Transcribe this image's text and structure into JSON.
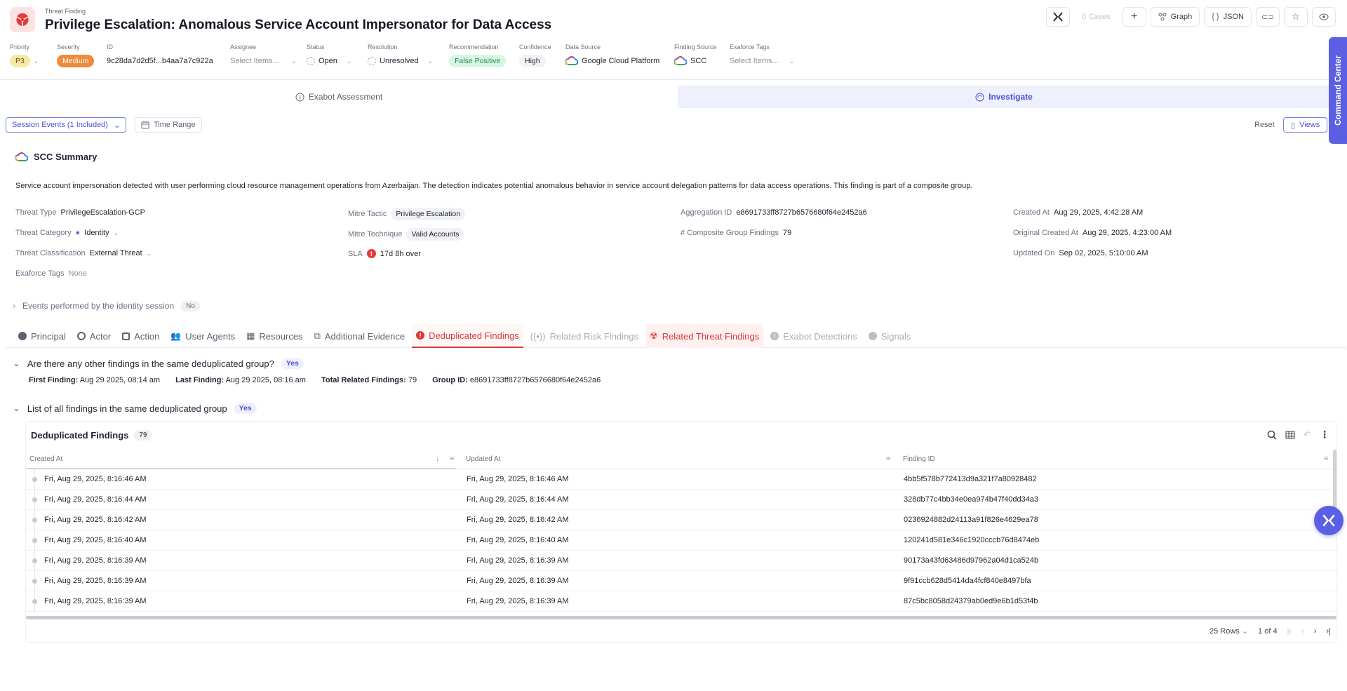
{
  "header": {
    "kicker": "Threat Finding",
    "title": "Privilege Escalation: Anomalous Service Account Impersonator for Data Access",
    "actions": {
      "cases": "0 Cases",
      "graph": "Graph",
      "json": "JSON"
    }
  },
  "meta": {
    "priority": {
      "label": "Priority",
      "value": "P3"
    },
    "severity": {
      "label": "Severity",
      "value": "Medium"
    },
    "id": {
      "label": "ID",
      "value": "9c28da7d2d5f...b4aa7a7c922a"
    },
    "assignee": {
      "label": "Assignee",
      "value": "Select Items..."
    },
    "status": {
      "label": "Status",
      "value": "Open"
    },
    "resolution": {
      "label": "Resolution",
      "value": "Unresolved"
    },
    "recommendation": {
      "label": "Recommendation",
      "value": "False Positive"
    },
    "confidence": {
      "label": "Confidence",
      "value": "High"
    },
    "data_source": {
      "label": "Data Source",
      "value": "Google Cloud Platform"
    },
    "finding_source": {
      "label": "Finding Source",
      "value": "SCC"
    },
    "exaforce_tags": {
      "label": "Exaforce Tags",
      "value": "Select Items..."
    }
  },
  "tabs": {
    "assessment": "Exabot Assessment",
    "investigate": "Investigate"
  },
  "filters": {
    "session": "Session Events (1 Included)",
    "time_range": "Time Range",
    "reset": "Reset",
    "views": "Views"
  },
  "command_center": "Command Center",
  "summary": {
    "title": "SCC Summary",
    "description": "Service account impersonation detected with user performing cloud resource management operations from Azerbaijan. The detection indicates potential anomalous behavior in service account delegation patterns for data access operations. This finding is part of a composite group.",
    "threat_type": {
      "label": "Threat Type",
      "value": "PrivilegeEscalation-GCP"
    },
    "threat_category": {
      "label": "Threat Category",
      "value": "Identity"
    },
    "threat_classification": {
      "label": "Threat Classification",
      "value": "External Threat"
    },
    "exaforce_tags": {
      "label": "Exaforce Tags",
      "value": "None"
    },
    "mitre_tactic": {
      "label": "Mitre Tactic",
      "value": "Privilege Escalation"
    },
    "mitre_technique": {
      "label": "Mitre Technique",
      "value": "Valid Accounts"
    },
    "sla": {
      "label": "SLA",
      "value": "17d 8h over"
    },
    "aggregation_id": {
      "label": "Aggregation ID",
      "value": "e8691733ff8727b6576680f64e2452a6"
    },
    "composite": {
      "label": "# Composite Group Findings",
      "value": "79"
    },
    "created_at": {
      "label": "Created At",
      "value": "Aug 29, 2025, 4:42:28 AM"
    },
    "original_created_at": {
      "label": "Original Created At",
      "value": "Aug 29, 2025, 4:23:00 AM"
    },
    "updated_on": {
      "label": "Updated On",
      "value": "Sep 02, 2025, 5:10:00 AM"
    }
  },
  "events": {
    "label": "Events performed by the identity session",
    "badge": "No"
  },
  "subtabs": [
    "Principal",
    "Actor",
    "Action",
    "User Agents",
    "Resources",
    "Additional Evidence",
    "Deduplicated Findings",
    "Related Risk Findings",
    "Related Threat Findings",
    "Exabot Detections",
    "Signals"
  ],
  "dedup": {
    "question1": "Are there any other findings in the same deduplicated group?",
    "answer1": "Yes",
    "first_finding_label": "First Finding:",
    "first_finding": "Aug 29 2025, 08:14 am",
    "last_finding_label": "Last Finding:",
    "last_finding": "Aug 29 2025, 08:16 am",
    "total_label": "Total Related Findings:",
    "total": "79",
    "group_label": "Group ID:",
    "group_id": "e8691733ff8727b6576680f64e2452a6",
    "question2": "List of all findings in the same deduplicated group",
    "answer2": "Yes"
  },
  "table": {
    "title": "Deduplicated Findings",
    "count": "79",
    "columns": [
      "Created At",
      "Updated At",
      "Finding ID"
    ],
    "rows": [
      [
        "Fri, Aug 29, 2025, 8:16:46 AM",
        "Fri, Aug 29, 2025, 8:16:46 AM",
        "4bb5f578b772413d9a321f7a80928482"
      ],
      [
        "Fri, Aug 29, 2025, 8:16:44 AM",
        "Fri, Aug 29, 2025, 8:16:44 AM",
        "328db77c4bb34e0ea974b47f40dd34a3"
      ],
      [
        "Fri, Aug 29, 2025, 8:16:42 AM",
        "Fri, Aug 29, 2025, 8:16:42 AM",
        "0236924882d24113a91f826e4629ea78"
      ],
      [
        "Fri, Aug 29, 2025, 8:16:40 AM",
        "Fri, Aug 29, 2025, 8:16:40 AM",
        "120241d581e346c1920cccb76d8474eb"
      ],
      [
        "Fri, Aug 29, 2025, 8:16:39 AM",
        "Fri, Aug 29, 2025, 8:16:39 AM",
        "90173a43fd63486d97962a04d1ca524b"
      ],
      [
        "Fri, Aug 29, 2025, 8:16:39 AM",
        "Fri, Aug 29, 2025, 8:16:39 AM",
        "9f91ccb628d5414da4fcf840e8497bfa"
      ],
      [
        "Fri, Aug 29, 2025, 8:16:39 AM",
        "Fri, Aug 29, 2025, 8:16:39 AM",
        "87c5bc8058d24379ab0ed9e6b1d53f4b"
      ]
    ],
    "rows_per_page": "25 Rows",
    "page": "1",
    "page_of": "of 4"
  },
  "colors": {
    "accent": "#5b5fe3",
    "danger": "#d83a3a",
    "severity_medium": "#f08a3c",
    "priority_p3": "#f7e7a8",
    "recommendation": "#d9f5e4"
  }
}
